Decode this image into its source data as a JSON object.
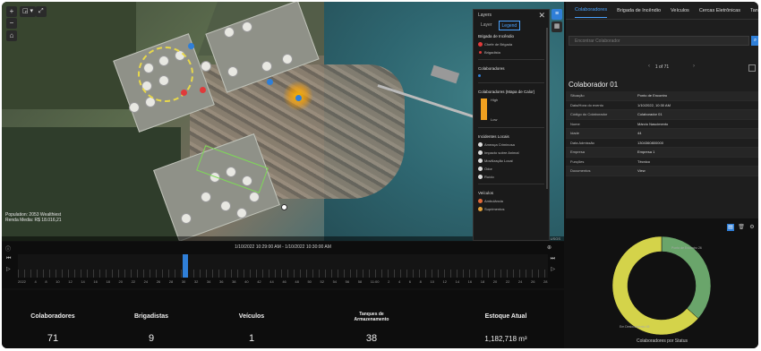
{
  "colors": {
    "accent": "#2f7fd8",
    "donut_yellow": "#d4d34a",
    "donut_green": "#6aa56b",
    "heat": "#f0a020"
  },
  "map": {
    "controls": [
      "+",
      "−",
      "⌂"
    ],
    "toolbar": [
      "◲ ▾",
      "⤢"
    ],
    "attribution": [
      "Population: 2053 Wealthiest",
      "Renda Media: R$ 18.016,21"
    ],
    "attribution_bar": "Esri, HERE, Garmin, USGS"
  },
  "legend": {
    "title": "Layers",
    "tabs": {
      "layer": "Layer",
      "legend": "Legend"
    },
    "sections": {
      "brigada": "Brigada de Incêndio",
      "brigada_items": [
        "Chefe de Brigada",
        "Brigadista"
      ],
      "colaboradores": "Colaboradores",
      "heatmap": "Colaboradores (Mapa de Calor)",
      "heat_high": "High",
      "heat_low": "Low",
      "incidentes": "Incidentes Locais",
      "incidentes_items": [
        "Ameaça Criminosa",
        "Impacto sobre Animal",
        "Movilização Local",
        "Odor",
        "Ruído"
      ],
      "veiculos": "Veículos",
      "veiculos_items": [
        "Ambulância",
        "Suprimentos"
      ]
    }
  },
  "timeline": {
    "range_label": "1/10/2022 10:29:00 AM - 1/10/2022 10:30:00 AM",
    "ticks": [
      "2022",
      "4",
      "8",
      "10",
      "12",
      "14",
      "16",
      "18",
      "20",
      "22",
      "24",
      "26",
      "28",
      "30",
      "32",
      "34",
      "36",
      "38",
      "40",
      "42",
      "44",
      "46",
      "48",
      "50",
      "52",
      "54",
      "56",
      "58",
      "11:00",
      "2",
      "4",
      "6",
      "8",
      "10",
      "12",
      "14",
      "16",
      "18",
      "20",
      "22",
      "24",
      "26",
      "28"
    ]
  },
  "stats": [
    {
      "label": "Colaboradores",
      "value": "71"
    },
    {
      "label": "Brigadistas",
      "value": "9"
    },
    {
      "label": "Veículos",
      "value": "1"
    },
    {
      "label": "Tanques de Armazenamento",
      "value": "38"
    },
    {
      "label": "Estoque Atual",
      "value": "1,182,718 m³"
    }
  ],
  "panel": {
    "tabs": [
      "Colaboradores",
      "Brigada de Incêndio",
      "Veículos",
      "Cercas Eletrônicas",
      "Tanques de Ar"
    ],
    "search_placeholder": "Encontrar Colaborador",
    "pager": "1 of 71",
    "record_title": "Colaborador 01",
    "attributes": [
      {
        "k": "Situação",
        "v": "Ponto de Encontro"
      },
      {
        "k": "Data/Hora do evento",
        "v": "1/10/2022, 10:30 AM"
      },
      {
        "k": "Código do Colaborador",
        "v": "Colaborador 01"
      },
      {
        "k": "Nome",
        "v": "Márcio Nascimento"
      },
      {
        "k": "Idade",
        "v": "44"
      },
      {
        "k": "Data Admissão",
        "v": "1304360800000"
      },
      {
        "k": "Empresa",
        "v": "Empresa 1"
      },
      {
        "k": "Funções",
        "v": "Técnico"
      },
      {
        "k": "Documentos",
        "v": "View"
      }
    ]
  },
  "chart": {
    "title": "Colaboradores por Status",
    "label_green": "Ponto de Encontro 26",
    "label_yellow": "Em Deslocamento 45"
  },
  "chart_data": {
    "type": "pie",
    "title": "Colaboradores por Status",
    "categories": [
      "Ponto de Encontro",
      "Em Deslocamento"
    ],
    "values": [
      26,
      45
    ]
  }
}
